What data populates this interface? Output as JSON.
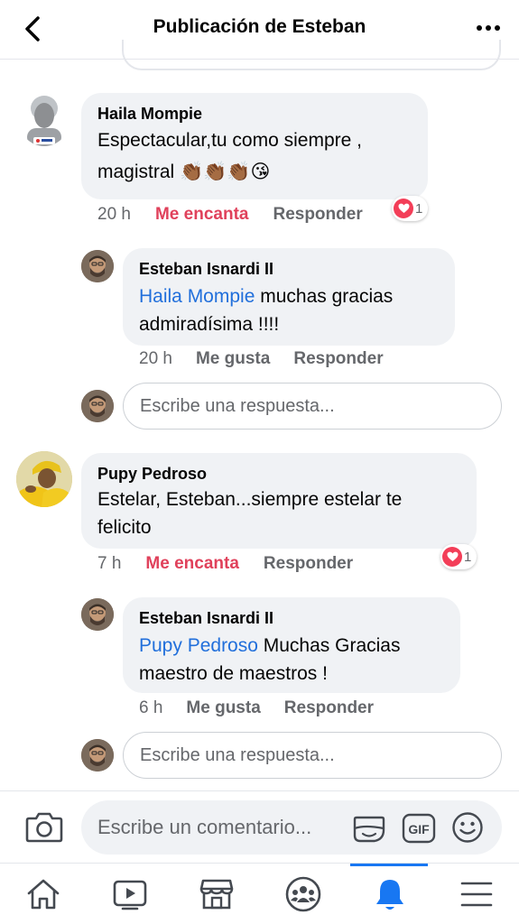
{
  "header": {
    "title": "Publicación de Esteban"
  },
  "comments": [
    {
      "author": "Haila Mompie",
      "text": "Espectacular,tu como siempre ,",
      "text2": "magistral 👏🏾👏🏾👏🏾😘",
      "time": "20 h",
      "reaction_action": "Me encanta",
      "reply_action": "Responder",
      "reaction_count": "1",
      "reply": {
        "author": "Esteban Isnardi II",
        "mention": "Haila Mompie",
        "text": " muchas gracias",
        "text2": "admiradísima !!!!",
        "time": "20 h",
        "like_action": "Me gusta",
        "reply_action": "Responder"
      },
      "reply_placeholder": "Escribe una respuesta..."
    },
    {
      "author": "Pupy Pedroso",
      "text": "Estelar, Esteban...siempre estelar  te",
      "text2": "felicito",
      "time": "7 h",
      "reaction_action": "Me encanta",
      "reply_action": "Responder",
      "reaction_count": "1",
      "reply": {
        "author": "Esteban Isnardi II",
        "mention": "Pupy Pedroso",
        "text": " Muchas Gracias",
        "text2": "maestro de maestros !",
        "time": "6 h",
        "like_action": "Me gusta",
        "reply_action": "Responder"
      },
      "reply_placeholder": "Escribe una respuesta..."
    }
  ],
  "composer": {
    "placeholder": "Escribe un comentario...",
    "gif_label": "GIF"
  },
  "colors": {
    "love": "#e0415b",
    "link": "#216fdb",
    "active_tab": "#1877f2"
  },
  "tabs": [
    "home-icon",
    "video-icon",
    "marketplace-icon",
    "groups-icon",
    "notifications-icon",
    "menu-icon"
  ]
}
